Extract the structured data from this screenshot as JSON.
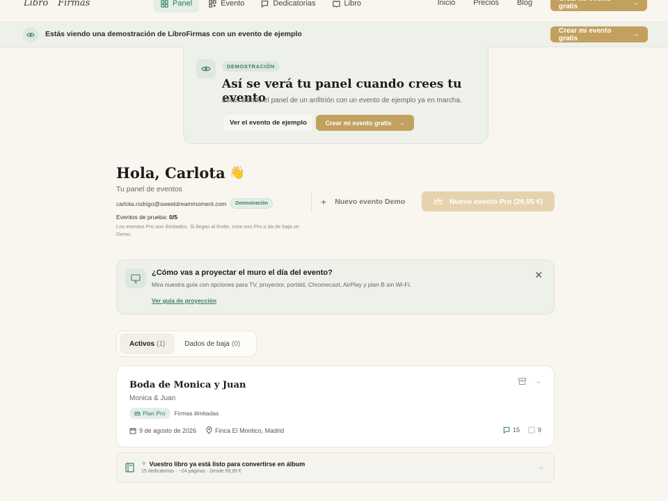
{
  "nav": {
    "logo_left": "Libro",
    "logo_right": "Firmas",
    "tabs": [
      {
        "label": "Panel",
        "icon": "grid-icon"
      },
      {
        "label": "Evento",
        "icon": "grid-plus-icon"
      },
      {
        "label": "Dedicatorias",
        "icon": "chat-icon"
      },
      {
        "label": "Libro",
        "icon": "book-icon"
      }
    ],
    "links": [
      "Inicio",
      "Precios",
      "Blog"
    ],
    "cta": "Crear mi evento gratis"
  },
  "demo_banner": {
    "text": "Estás viendo una demostración de LibroFirmas con un evento de ejemplo",
    "cta": "Crear mi evento gratis"
  },
  "hero": {
    "tag": "DEMOSTRACIÓN",
    "title": "Así se verá tu panel cuando crees tu evento",
    "subtitle": "Estás viendo el panel de un anfitrión con un evento de ejemplo ya en marcha.",
    "btn_example": "Ver el evento de ejemplo",
    "btn_create": "Crear mi evento gratis"
  },
  "greeting": {
    "title": "Hola, Carlota",
    "wave": "👋",
    "subtitle": "Tu panel de eventos",
    "email": "carlota.rodrigo@sweetdreammoment.com",
    "badge": "Demostración",
    "trial_label": "Eventos de prueba:",
    "trial_value": "0/5",
    "trial_note": "Los eventos Pro son ilimitados. Si llegas al límite, crea uno Pro o da de baja un Demo."
  },
  "actions": {
    "new_demo": "Nuevo evento Demo",
    "new_pro": "Nuevo evento Pro (29,95 €)"
  },
  "projection": {
    "title": "¿Cómo vas a proyectar el muro el día del evento?",
    "desc": "Mira nuestra guía con opciones para TV, proyector, portátil, Chromecast, AirPlay y plan B sin Wi-Fi.",
    "link": "Ver guía de proyección"
  },
  "tabs": [
    {
      "label": "Activos",
      "count": "(1)"
    },
    {
      "label": "Dados de baja",
      "count": "(0)"
    }
  ],
  "event": {
    "title": "Boda de Monica y Juan",
    "couple": "Monica & Juan",
    "plan": "Plan Pro",
    "plan_note": "Firmas ilimitadas",
    "date": "9 de agosto de 2026",
    "place": "Finca El Montico, Madrid",
    "messages": "15",
    "photos": "9"
  },
  "album": {
    "title": "Vuestro libro ya está listo para convertirse en álbum",
    "sub": "15 dedicatorias · ~24 páginas · Desde 99,99 €"
  },
  "colors": {
    "accent_green": "#2e7d5b",
    "gold": "#c2a05e",
    "background": "#f9f6ef"
  }
}
